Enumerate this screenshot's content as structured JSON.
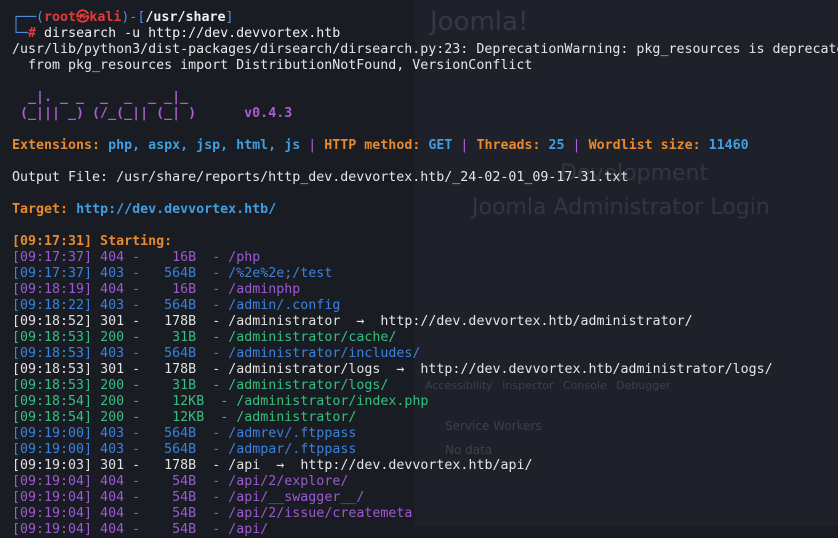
{
  "background": {
    "brand": "Joomla!",
    "sub": "Development",
    "login": "Joomla Administrator Login",
    "devbar": "Accessibility Inspector Console Debugger",
    "sw": "Service Workers",
    "nd": "No data"
  },
  "prompt": {
    "open": "┌──(",
    "user": "root",
    "at": "㉿",
    "host": "kali",
    "mid": ")-[",
    "cwd": "/usr/share",
    "close": "]",
    "line2": "└─",
    "hash": "#",
    "command": "dirsearch -u http://dev.devvortex.htb"
  },
  "warning": {
    "line1": "/usr/lib/python3/dist-packages/dirsearch/dirsearch.py:23: DeprecationWarning: pkg_resources is deprecated",
    "line2": "  from pkg_resources import DistributionNotFound, VersionConflict"
  },
  "banner": {
    "line1": "  _|. _ _  _  _  _ _|_",
    "line2": " (_||| _) (/_(_|| (_| )",
    "version": "v0.4.3"
  },
  "config": {
    "ext_label": "Extensions:",
    "ext_value": "php, aspx, jsp, html, js",
    "sep": "|",
    "method_label": "HTTP method:",
    "method_value": "GET",
    "threads_label": "Threads:",
    "threads_value": "25",
    "wordlist_label": "Wordlist size:",
    "wordlist_value": "11460"
  },
  "output_file": "Output File: /usr/share/reports/http_dev.devvortex.htb/_24-02-01_09-17-31.txt",
  "target": {
    "label": "Target:",
    "url": "http://dev.devvortex.htb/"
  },
  "starting": "[09:17:31] Starting:",
  "results": [
    {
      "time": "[09:17:37]",
      "code": "404",
      "size": "   16B",
      "path": "/php",
      "redirect": ""
    },
    {
      "time": "[09:17:37]",
      "code": "403",
      "size": "  564B",
      "path": "/%2e%2e;/test",
      "redirect": ""
    },
    {
      "time": "[09:18:19]",
      "code": "404",
      "size": "   16B",
      "path": "/adminphp",
      "redirect": ""
    },
    {
      "time": "[09:18:22]",
      "code": "403",
      "size": "  564B",
      "path": "/admin/.config",
      "redirect": ""
    },
    {
      "time": "[09:18:52]",
      "code": "301",
      "size": "  178B",
      "path": "/administrator",
      "redirect": "http://dev.devvortex.htb/administrator/"
    },
    {
      "time": "[09:18:53]",
      "code": "200",
      "size": "   31B",
      "path": "/administrator/cache/",
      "redirect": ""
    },
    {
      "time": "[09:18:53]",
      "code": "403",
      "size": "  564B",
      "path": "/administrator/includes/",
      "redirect": ""
    },
    {
      "time": "[09:18:53]",
      "code": "301",
      "size": "  178B",
      "path": "/administrator/logs",
      "redirect": "http://dev.devvortex.htb/administrator/logs/"
    },
    {
      "time": "[09:18:53]",
      "code": "200",
      "size": "   31B",
      "path": "/administrator/logs/",
      "redirect": ""
    },
    {
      "time": "[09:18:54]",
      "code": "200",
      "size": "   12KB",
      "path": "/administrator/index.php",
      "redirect": ""
    },
    {
      "time": "[09:18:54]",
      "code": "200",
      "size": "   12KB",
      "path": "/administrator/",
      "redirect": ""
    },
    {
      "time": "[09:19:00]",
      "code": "403",
      "size": "  564B",
      "path": "/admrev/.ftppass",
      "redirect": ""
    },
    {
      "time": "[09:19:00]",
      "code": "403",
      "size": "  564B",
      "path": "/admpar/.ftppass",
      "redirect": ""
    },
    {
      "time": "[09:19:03]",
      "code": "301",
      "size": "  178B",
      "path": "/api",
      "redirect": "http://dev.devvortex.htb/api/"
    },
    {
      "time": "[09:19:04]",
      "code": "404",
      "size": "   54B",
      "path": "/api/2/explore/",
      "redirect": ""
    },
    {
      "time": "[09:19:04]",
      "code": "404",
      "size": "   54B",
      "path": "/api/__swagger__/",
      "redirect": ""
    },
    {
      "time": "[09:19:04]",
      "code": "404",
      "size": "   54B",
      "path": "/api/2/issue/createmeta",
      "redirect": ""
    },
    {
      "time": "[09:19:04]",
      "code": "404",
      "size": "   54B",
      "path": "/api/",
      "redirect": ""
    }
  ],
  "arrow": "→",
  "dash": "-"
}
